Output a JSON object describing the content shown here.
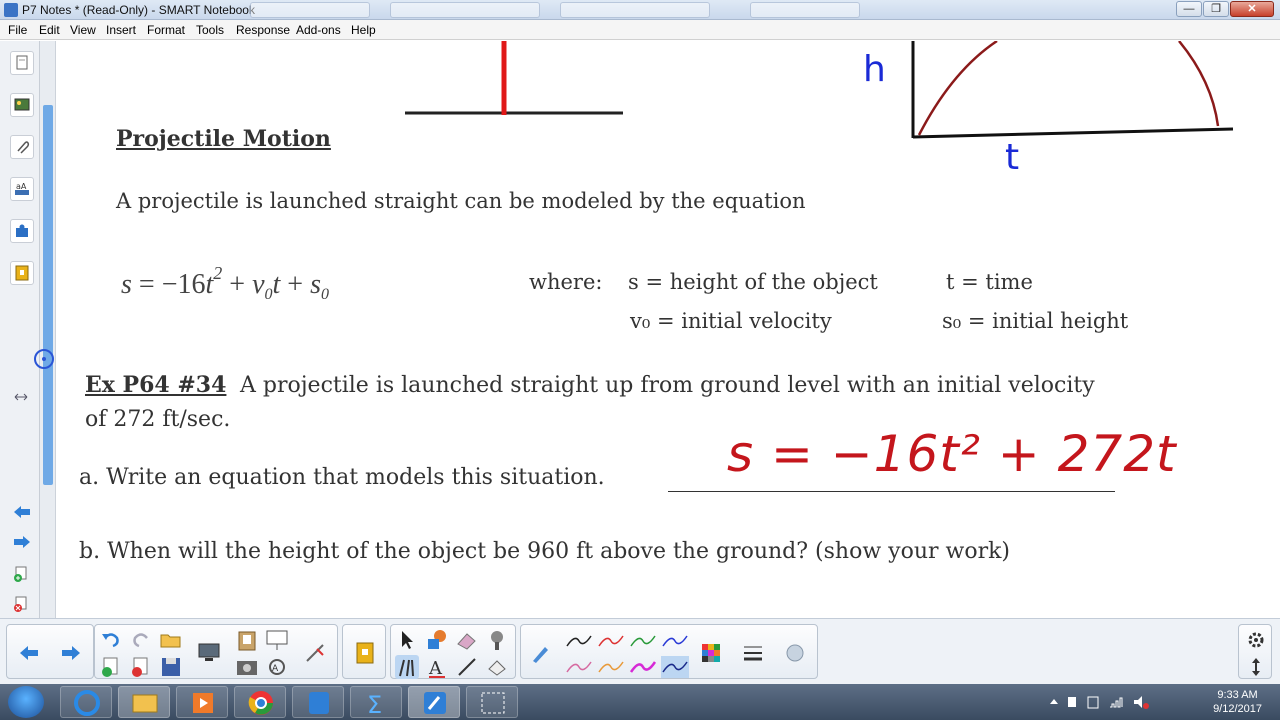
{
  "window": {
    "title": "P7 Notes * (Read-Only) - SMART Notebook",
    "minimize_glyph": "—",
    "maximize_glyph": "❐",
    "close_glyph": "✕"
  },
  "menu": [
    "File",
    "Edit",
    "View",
    "Insert",
    "Format",
    "Tools",
    "Response",
    "Add-ons",
    "Help"
  ],
  "page": {
    "graph_axis_label_h": "h",
    "graph_axis_label_t": "t",
    "heading": "Projectile Motion",
    "intro": "A projectile is launched straight can be modeled by the equation",
    "equation": {
      "s": "s",
      "eq": " = −16",
      "t": "t",
      "exp": "2",
      "plus1": " + ",
      "v": "v",
      "sub0": "0",
      "t2": "t",
      "plus2": " + ",
      "s2": "s",
      "sub0b": "0"
    },
    "where_label": "where:",
    "definitions": {
      "s_def": "s = height of the object",
      "t_def": "t = time",
      "v0_def": "v₀ = initial velocity",
      "s0_def": "s₀ = initial height"
    },
    "example_title": "Ex P64 #34",
    "example_line1": "A projectile is launched straight up from ground level with an initial velocity",
    "example_line2": "of 272 ft/sec.",
    "part_a": "a. Write an equation that models this situation.",
    "handwritten_answer": "s = −16t² + 272t",
    "part_b": "b.  When will the height of the object be 960 ft above the ground? (show your work)"
  },
  "colors": {
    "ink_red": "#c4161c",
    "ink_dark_red": "#8b1a1a",
    "ink_blue": "#1a2ad6",
    "text_gray": "#333333",
    "scroll_blue": "#6fa9e6"
  },
  "taskbar": {
    "time": "9:33 AM",
    "date": "9/12/2017"
  }
}
